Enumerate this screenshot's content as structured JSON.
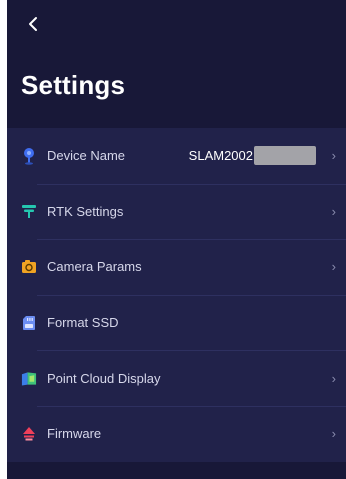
{
  "header": {
    "back_icon": "chevron-left-icon",
    "title": "Settings"
  },
  "settings": {
    "items": [
      {
        "label": "Device Name",
        "icon": "location-pin-icon",
        "value": "SLAM2002",
        "value_redacted": true,
        "chevron": "›"
      },
      {
        "label": "RTK Settings",
        "icon": "antenna-icon",
        "chevron": "›"
      },
      {
        "label": "Camera Params",
        "icon": "camera-icon",
        "chevron": "›"
      },
      {
        "label": "Format SSD",
        "icon": "sd-card-icon"
      },
      {
        "label": "Point Cloud Display",
        "icon": "point-cloud-icon",
        "chevron": "›"
      },
      {
        "label": "Firmware",
        "icon": "firmware-icon",
        "chevron": "›"
      }
    ]
  },
  "colors": {
    "background": "#181838",
    "list_background": "#21224a",
    "title": "#ffffff",
    "label": "#d6d7ea",
    "pin_blue": "#3f6df0",
    "antenna_teal": "#25c7b0",
    "camera_orange": "#f0a323",
    "sd_blue": "#6b8df2",
    "cloud_green": "#3fc27a",
    "firmware_red": "#f0405a"
  }
}
